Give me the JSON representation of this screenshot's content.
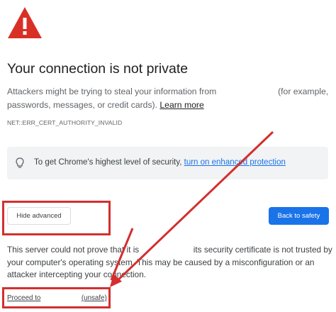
{
  "page": {
    "title": "Your connection is not private",
    "description_part1": "Attackers might be trying to steal your information from",
    "description_part2": "(for example, passwords, messages, or credit cards).",
    "learn_more": "Learn more",
    "error_code": "NET::ERR_CERT_AUTHORITY_INVALID"
  },
  "tip": {
    "text": "To get Chrome's highest level of security,",
    "link": "turn on enhanced protection",
    "icon": "lightbulb-icon"
  },
  "buttons": {
    "hide_advanced": "Hide advanced",
    "back_to_safety": "Back to safety"
  },
  "advanced": {
    "text_part1": "This server could not prove that it is",
    "text_part2": "its security certificate is not trusted by your computer's operating system. This may be caused by a misconfiguration or an attacker intercepting your connection."
  },
  "proceed": {
    "label": "Proceed to",
    "unsafe": "(unsafe)"
  },
  "colors": {
    "warning_red": "#d93025",
    "accent_blue": "#1a73e8",
    "annotation_red": "#d32f2f"
  }
}
